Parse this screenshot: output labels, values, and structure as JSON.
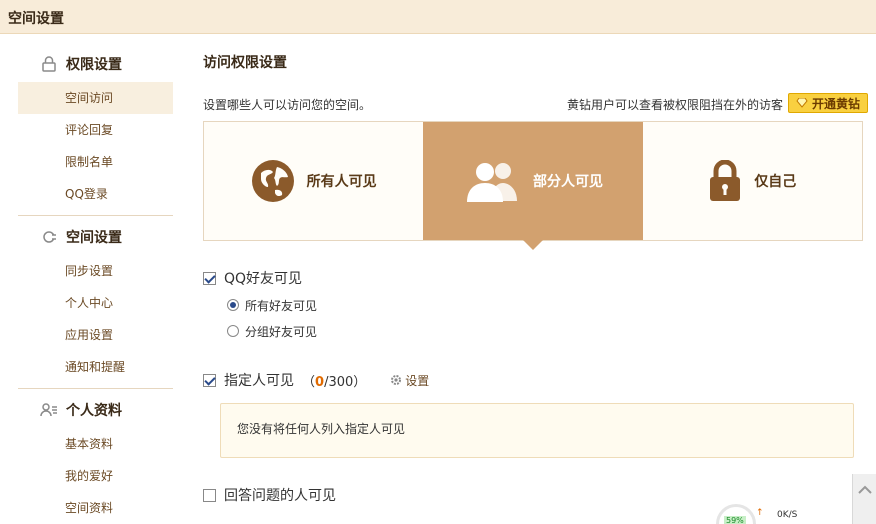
{
  "window": {
    "title": "空间设置"
  },
  "sidebar": {
    "groups": [
      {
        "label": "权限设置",
        "icon": "lock-icon",
        "items": [
          "空间访问",
          "评论回复",
          "限制名单",
          "QQ登录"
        ]
      },
      {
        "label": "空间设置",
        "icon": "wrench-icon",
        "items": [
          "同步设置",
          "个人中心",
          "应用设置",
          "通知和提醒"
        ]
      },
      {
        "label": "个人资料",
        "icon": "user-profile-icon",
        "items": [
          "基本资料",
          "我的爱好",
          "空间资料"
        ]
      }
    ],
    "active_item": "空间访问"
  },
  "main": {
    "heading": "访问权限设置",
    "description": "设置哪些人可以访问您的空间。",
    "vip_note": "黄钻用户可以查看被权限阻挡在外的访客",
    "vip_button": "开通黄钻",
    "options": [
      {
        "label": "所有人可见",
        "icon": "globe-icon",
        "selected": false
      },
      {
        "label": "部分人可见",
        "icon": "people-icon",
        "selected": true
      },
      {
        "label": "仅自己",
        "icon": "padlock-icon",
        "selected": false
      }
    ],
    "qq_friends": {
      "label": "QQ好友可见",
      "checked": true,
      "radio_all": "所有好友可见",
      "radio_group": "分组好友可见",
      "selected": "所有好友可见"
    },
    "designated": {
      "label": "指定人可见",
      "paren_open": "（",
      "count_now": "0",
      "count_max": "/300",
      "paren_close": "）",
      "checked": true,
      "settings_link": "设置",
      "notice": "您没有将任何人列入指定人可见"
    },
    "answer_question": {
      "label": "回答问题的人可见",
      "checked": false
    }
  },
  "speed_widget": {
    "percent": "59%",
    "rate": "0K/S"
  },
  "colors": {
    "selected_option": "#d2a16f",
    "topbar": "#f8ecd9",
    "vip": "#f9d040",
    "count_accent": "#e06a00"
  }
}
